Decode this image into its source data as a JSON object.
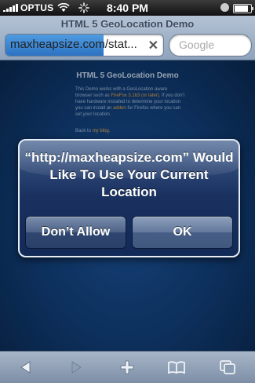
{
  "status_bar": {
    "carrier": "OPTUS",
    "time": "8:40 PM",
    "battery_level": 0.9,
    "signal_bars": 5
  },
  "browser": {
    "page_title": "HTML 5 GeoLocation Demo",
    "url": "maxheapsize.com/stat...",
    "url_load_progress": 0.62,
    "search_placeholder": "Google",
    "toolbar_icons": [
      "back-icon",
      "forward-icon",
      "add-bookmark-icon",
      "bookmarks-icon",
      "pages-icon"
    ]
  },
  "webpage": {
    "heading": "HTML 5 GeoLocation Demo",
    "body_before_link1": "This Demo works with a GeoLocation aware browser such as",
    "link1": "FireFox 3.1b3 (or later)",
    "body_after_link1": ". If you don't have hardware installed to determine your location you can install an",
    "link2": "addon",
    "body_after_link2": "for Firefox where you can set your location.",
    "back_text": "Back to",
    "back_link": "my blog"
  },
  "alert": {
    "message": "“http://maxheapsize.com” Would Like To Use Your Current Location",
    "deny_label": "Don’t Allow",
    "allow_label": "OK"
  },
  "colors": {
    "page_background": "#12427f",
    "link": "#f2b04c",
    "alert_background": "#1a3160"
  }
}
